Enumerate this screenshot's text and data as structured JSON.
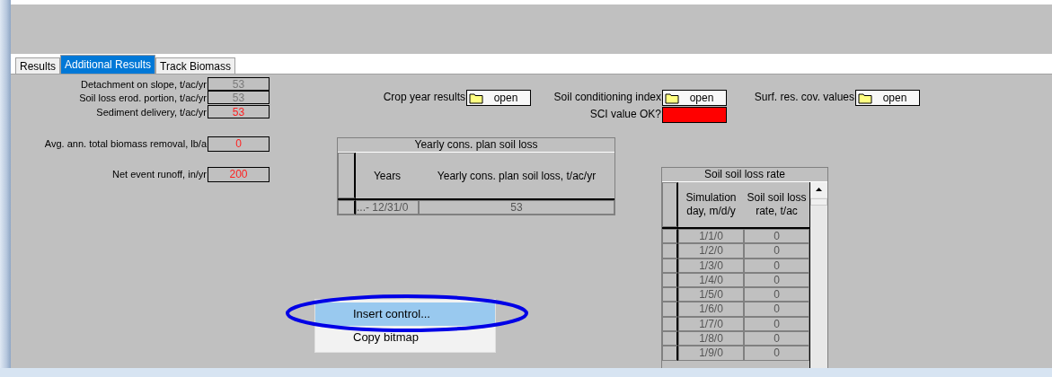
{
  "tabs": [
    {
      "label": "Results",
      "selected": false
    },
    {
      "label": "Additional Results",
      "selected": true
    },
    {
      "label": "Track Biomass",
      "selected": false
    }
  ],
  "fields": [
    {
      "label": "Detachment on slope, t/ac/yr",
      "value": "53",
      "alert": false
    },
    {
      "label": "Soil loss erod. portion, t/ac/yr",
      "value": "53",
      "alert": false
    },
    {
      "label": "Sediment delivery, t/ac/yr",
      "value": "53",
      "alert": true
    },
    {
      "label": "Avg. ann. total biomass removal, lb/a",
      "value": "0",
      "alert": true
    },
    {
      "label": "Net event runoff, in/yr",
      "value": "200",
      "alert": true
    }
  ],
  "open_buttons": [
    {
      "label": "Crop year results",
      "button": "open"
    },
    {
      "label": "Soil conditioning index",
      "button": "open"
    },
    {
      "label": "Surf. res. cov. values",
      "button": "open"
    }
  ],
  "sci_check": {
    "label": "SCI value OK?",
    "ok": false
  },
  "yearly_table": {
    "title": "Yearly cons. plan soil loss",
    "columns": [
      "Years",
      "Yearly cons. plan soil loss, t/ac/yr"
    ],
    "rows": [
      [
        "...- 12/31/0",
        "53"
      ]
    ]
  },
  "rate_table": {
    "title": "Soil soil loss rate",
    "columns": [
      "Simulation day, m/d/y",
      "Soil soil loss rate, t/ac"
    ],
    "rows": [
      [
        "1/1/0",
        "0"
      ],
      [
        "1/2/0",
        "0"
      ],
      [
        "1/3/0",
        "0"
      ],
      [
        "1/4/0",
        "0"
      ],
      [
        "1/5/0",
        "0"
      ],
      [
        "1/6/0",
        "0"
      ],
      [
        "1/7/0",
        "0"
      ],
      [
        "1/8/0",
        "0"
      ],
      [
        "1/9/0",
        "0"
      ]
    ]
  },
  "context_menu": {
    "items": [
      {
        "label": "Insert control...",
        "selected": true
      },
      {
        "label": "Copy bitmap",
        "selected": false
      }
    ]
  }
}
